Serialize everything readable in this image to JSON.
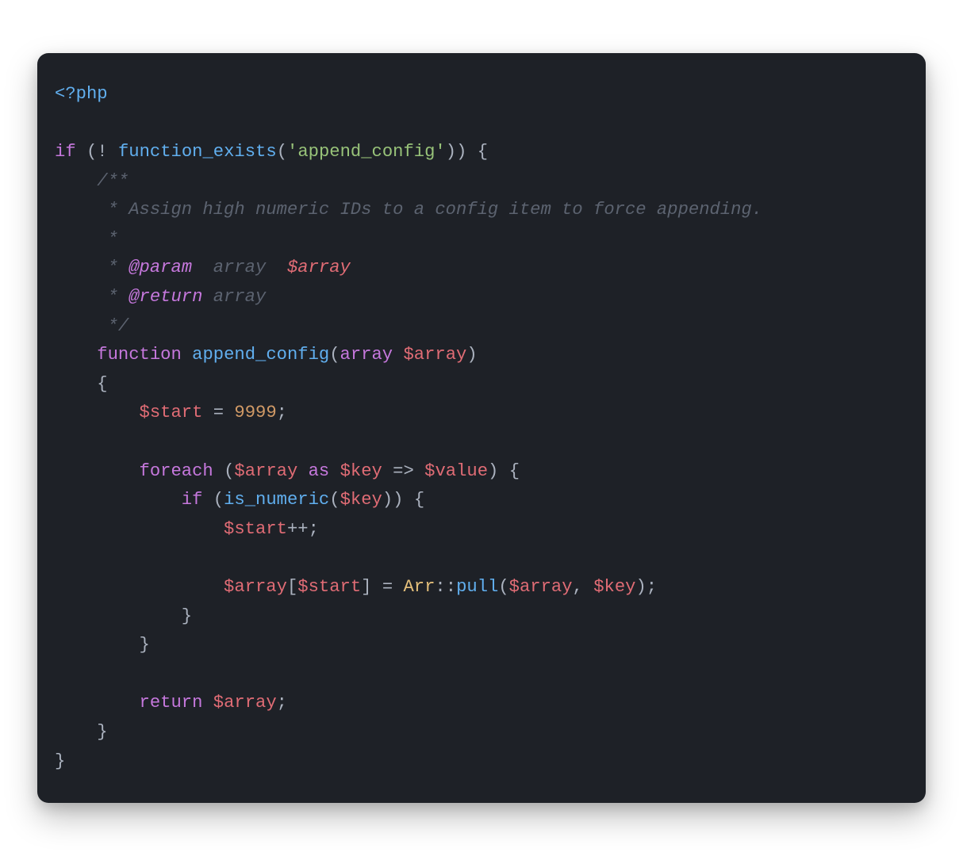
{
  "code": {
    "php_open": "<?php",
    "kw_if": "if",
    "punc_open_paren": "(",
    "op_not": "!",
    "fn_function_exists": "function_exists",
    "str_append_config": "'append_config'",
    "punc_close_paren": ")",
    "punc_close_paren2": ")",
    "punc_open_brace": "{",
    "doc_open": "/**",
    "doc_line_desc": "     * Assign high numeric IDs to a config item to force appending.",
    "doc_line_blank": "     *",
    "doc_line_param_lead": "     * ",
    "doc_tag_param": "@param",
    "doc_param_rest": "  array  ",
    "doc_param_var": "$array",
    "doc_line_return_lead": "     * ",
    "doc_tag_return": "@return",
    "doc_return_rest": " array",
    "doc_close": "     */",
    "kw_function": "function",
    "fname_append_config": "append_config",
    "type_array": "array",
    "var_array_param": "$array",
    "punc_open_brace2": "{",
    "var_start": "$start",
    "op_assign": "=",
    "num_9999": "9999",
    "punc_semi": ";",
    "kw_foreach": "foreach",
    "var_array_iter": "$array",
    "kw_as": "as",
    "var_key": "$key",
    "op_arrow": "=>",
    "var_value": "$value",
    "punc_open_brace3": "{",
    "kw_if2": "if",
    "fn_is_numeric": "is_numeric",
    "var_key2": "$key",
    "punc_open_brace4": "{",
    "var_start2": "$start",
    "op_inc": "++",
    "var_array_idx": "$array",
    "punc_open_bracket": "[",
    "var_start3": "$start",
    "punc_close_bracket": "]",
    "op_assign2": "=",
    "const_Arr": "Arr",
    "op_dcolon": "::",
    "fn_pull": "pull",
    "var_array_arg": "$array",
    "punc_comma": ",",
    "var_key3": "$key",
    "punc_close_brace4": "}",
    "punc_close_brace3": "}",
    "kw_return": "return",
    "var_array_ret": "$array",
    "punc_close_brace2": "}",
    "punc_close_brace1": "}"
  }
}
